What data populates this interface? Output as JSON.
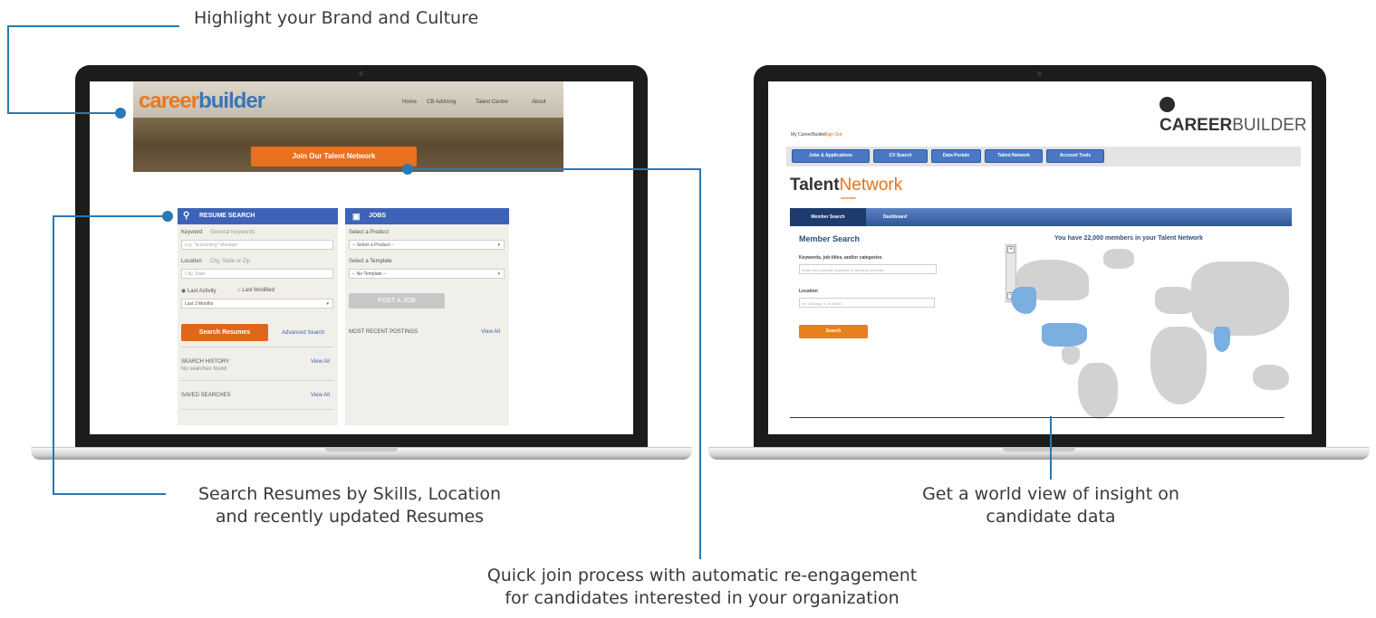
{
  "callouts": {
    "brand": "Highlight your Brand and Culture",
    "search_line1": "Search Resumes by Skills, Location",
    "search_line2": "and recently updated Resumes",
    "world_line1": "Get a world view of insight on",
    "world_line2": "candidate data",
    "join_line1": "Quick join process with automatic re-engagement",
    "join_line2": "for candidates interested in your organization"
  },
  "left_screen": {
    "logo_part1": "career",
    "logo_part2": "builder",
    "nav": [
      "Home",
      "CB Advising",
      "Talent Centre",
      "About"
    ],
    "join_button": "Join Our Talent Network",
    "resume_panel": {
      "title": "RESUME SEARCH",
      "keyword_label": "Keyword",
      "keyword_hint": "General Keywords",
      "keyword_placeholder": "e.g. \"accounting\" Manager",
      "location_label": "Location",
      "location_hint": "City, State or Zip",
      "location_placeholder": "City, State",
      "radio_active": "Last Activity",
      "radio_modified": "Last Modified",
      "select_value": "Last 3 Months",
      "search_button": "Search Resumes",
      "advanced_link": "Advanced Search",
      "history_label": "SEARCH HISTORY",
      "history_empty": "No searches found",
      "history_link": "View All",
      "saved_label": "SAVED SEARCHES",
      "saved_link": "View All"
    },
    "jobs_panel": {
      "title": "JOBS",
      "product_label": "Select a Product",
      "product_value": "-- Select a Product --",
      "template_label": "Select a Template",
      "template_value": "-- No Template --",
      "post_button": "POST A JOB",
      "recent_label": "MOST RECENT POSTINGS",
      "recent_link": "View All"
    }
  },
  "right_screen": {
    "brand_word1": "CAREER",
    "brand_word2": "BUILDER",
    "account_label": "My CareerBuilder",
    "account_link": "Sign Out",
    "tabs": [
      "Jobs & Applications",
      "CV Search",
      "Data Portals",
      "Talent Network",
      "Account Tools"
    ],
    "talent_word1": "Talent",
    "talent_word2": "Network",
    "talent_sub": "workable",
    "subtabs": [
      "Member Search",
      "Dashboard"
    ],
    "member_title": "Member Search",
    "members_headline": "You have 22,000 members in your Talent Network",
    "keywords_label": "Keywords, job titles, and/or categories",
    "keywords_placeholder": "Enter and separate keywords or terms by commas",
    "location_label": "Location",
    "location_placeholder": "ex: Chicago, IL or 60601",
    "search_button": "Search"
  },
  "colors": {
    "accent_blue": "#2a78b4",
    "orange": "#e8701e",
    "panel_blue": "#3d63b8",
    "map_highlight": "#7aafe0"
  }
}
